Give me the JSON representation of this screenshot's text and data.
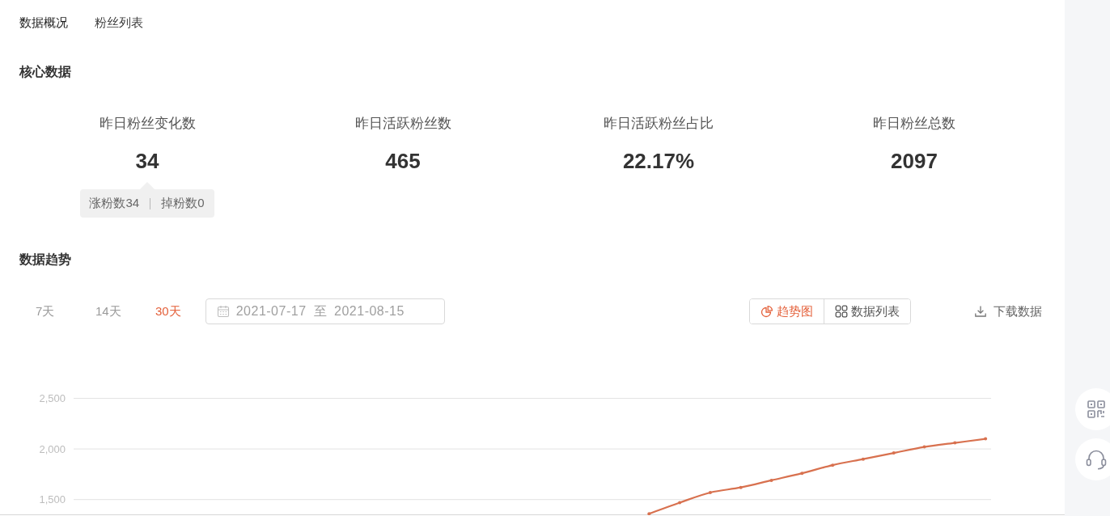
{
  "tabs": [
    {
      "label": "数据概况",
      "selected": true
    },
    {
      "label": "粉丝列表",
      "selected": false
    }
  ],
  "core_data": {
    "title": "核心数据",
    "metrics": [
      {
        "label": "昨日粉丝变化数",
        "value": "34",
        "tooltip": {
          "items": [
            "涨粉数34",
            "掉粉数0"
          ]
        }
      },
      {
        "label": "昨日活跃粉丝数",
        "value": "465"
      },
      {
        "label": "昨日活跃粉丝占比",
        "value": "22.17%"
      },
      {
        "label": "昨日粉丝总数",
        "value": "2097"
      }
    ]
  },
  "trend": {
    "title": "数据趋势",
    "ranges": [
      {
        "label": "7天",
        "selected": false
      },
      {
        "label": "14天",
        "selected": false
      },
      {
        "label": "30天",
        "selected": true
      }
    ],
    "date_range": {
      "start": "2021-07-17",
      "separator": "至",
      "end": "2021-08-15"
    },
    "views": [
      {
        "label": "趋势图",
        "kind": "chart",
        "selected": true
      },
      {
        "label": "数据列表",
        "kind": "list",
        "selected": false
      }
    ],
    "download": {
      "label": "下载数据"
    },
    "chart_data": {
      "type": "line",
      "grid": true,
      "ylim": [
        1350,
        2500
      ],
      "yticks": [
        {
          "value": 1500,
          "label": "1,500"
        },
        {
          "value": 2000,
          "label": "2,000"
        },
        {
          "value": 2500,
          "label": "2,500"
        }
      ],
      "series": [
        {
          "color": "#d8714f",
          "values": [
            null,
            null,
            null,
            null,
            null,
            null,
            null,
            null,
            null,
            null,
            null,
            null,
            null,
            null,
            null,
            null,
            null,
            null,
            1360,
            1470,
            1570,
            1620,
            1690,
            1760,
            1840,
            1900,
            1960,
            2020,
            2060,
            2100
          ]
        }
      ]
    }
  }
}
